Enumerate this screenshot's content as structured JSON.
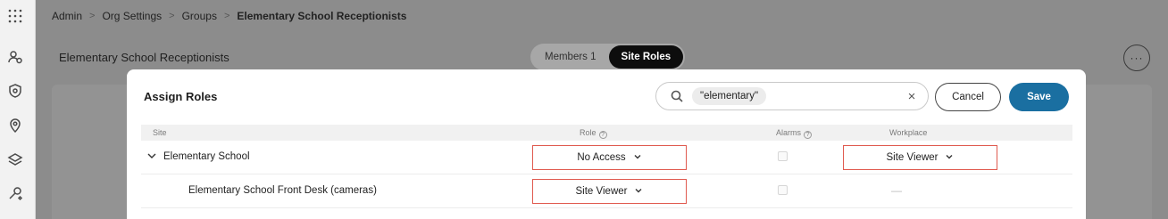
{
  "rail": {
    "icons": [
      "apps-grid-icon",
      "people-settings-icon",
      "shield-icon",
      "location-pin-icon",
      "layers-icon",
      "wrench-gear-icon"
    ]
  },
  "breadcrumb": {
    "items": [
      "Admin",
      "Org Settings",
      "Groups"
    ],
    "current": "Elementary School Receptionists"
  },
  "background": {
    "title": "Elementary School Receptionists",
    "tabs": [
      {
        "label": "Members 1",
        "active": false
      },
      {
        "label": "Site Roles",
        "active": true
      }
    ],
    "more_label": "···"
  },
  "modal": {
    "title": "Assign Roles",
    "search": {
      "chip": "\"elementary\"",
      "clear": "×"
    },
    "cancel_label": "Cancel",
    "save_label": "Save",
    "columns": {
      "site": "Site",
      "role": "Role",
      "alarms": "Alarms",
      "workplace": "Workplace",
      "help": "?"
    },
    "rows": [
      {
        "site": "Elementary School",
        "role": "No Access",
        "alarms": false,
        "workplace": "Site Viewer",
        "expanded": true
      },
      {
        "site": "Elementary School Front Desk (cameras)",
        "role": "Site Viewer",
        "alarms": false,
        "workplace": "—"
      }
    ]
  },
  "colors": {
    "accent": "#1a6fa1",
    "highlight": "#e05a4f",
    "active_tab": "#0d0d0d"
  }
}
